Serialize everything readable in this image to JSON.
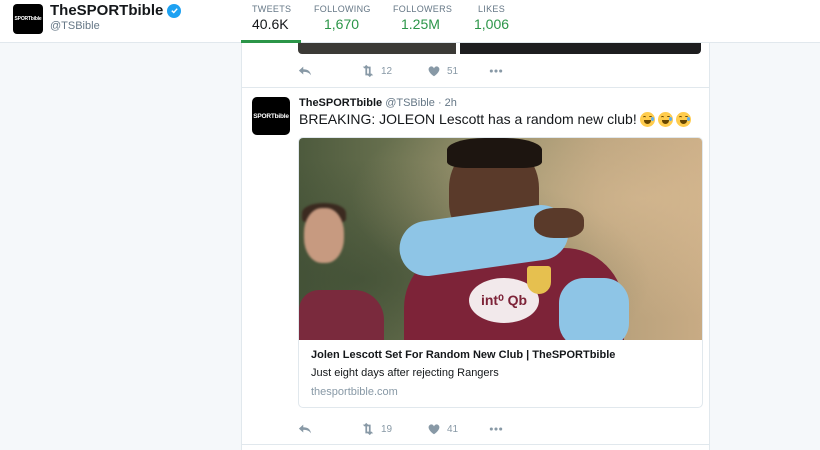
{
  "profile": {
    "avatar_text": "SPORTbible",
    "name": "TheSPORTbible",
    "handle": "@TSBible"
  },
  "stats": [
    {
      "label": "TWEETS",
      "value": "40.6K"
    },
    {
      "label": "FOLLOWING",
      "value": "1,670"
    },
    {
      "label": "FOLLOWERS",
      "value": "1.25M"
    },
    {
      "label": "LIKES",
      "value": "1,006"
    }
  ],
  "prev_tweet": {
    "retweets": "12",
    "likes": "51"
  },
  "tweet": {
    "avatar_text": "SPORTbible",
    "name": "TheSPORTbible",
    "handle": "@TSBible",
    "time": "· 2h",
    "text": "BREAKING: JOLEON Lescott has a random new club!",
    "emojis": [
      "joy-emoji",
      "joy-emoji",
      "joy-emoji"
    ],
    "card": {
      "sponsor_text": "int⁰ Qb",
      "title": "Jolen Lescott Set For Random New Club | TheSPORTbible",
      "description": "Just eight days after rejecting Rangers",
      "url": "thesportbible.com"
    },
    "retweets": "19",
    "likes": "41"
  },
  "colors": {
    "accent": "#2b9548",
    "verified": "#1da1f2",
    "muted": "#8899a6",
    "border": "#e1e8ed"
  }
}
